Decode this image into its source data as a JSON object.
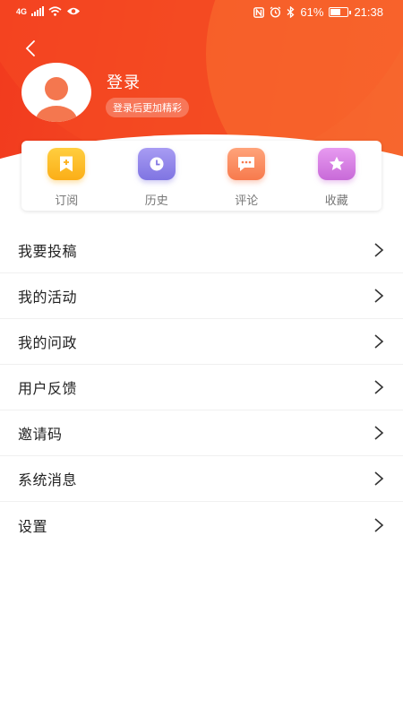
{
  "status_bar": {
    "signal_label": "4G",
    "battery_text": "61%",
    "battery_level": 0.61,
    "time": "21:38"
  },
  "profile": {
    "login_title": "登录",
    "login_tip": "登录后更加精彩"
  },
  "quick_actions": [
    {
      "label": "订阅",
      "icon": "bookmark-plus-icon"
    },
    {
      "label": "历史",
      "icon": "clock-icon"
    },
    {
      "label": "评论",
      "icon": "comment-icon"
    },
    {
      "label": "收藏",
      "icon": "star-icon"
    }
  ],
  "menu": [
    {
      "label": "我要投稿"
    },
    {
      "label": "我的活动"
    },
    {
      "label": "我的问政"
    },
    {
      "label": "用户反馈"
    },
    {
      "label": "邀请码"
    },
    {
      "label": "系统消息"
    },
    {
      "label": "设置"
    }
  ],
  "colors": {
    "header_red": "#f23a1e",
    "subscribe_yellow": "#fbae17",
    "history_purple": "#7f74e2",
    "comment_orange": "#f77a4d",
    "favorite_pink": "#c86ad8"
  }
}
